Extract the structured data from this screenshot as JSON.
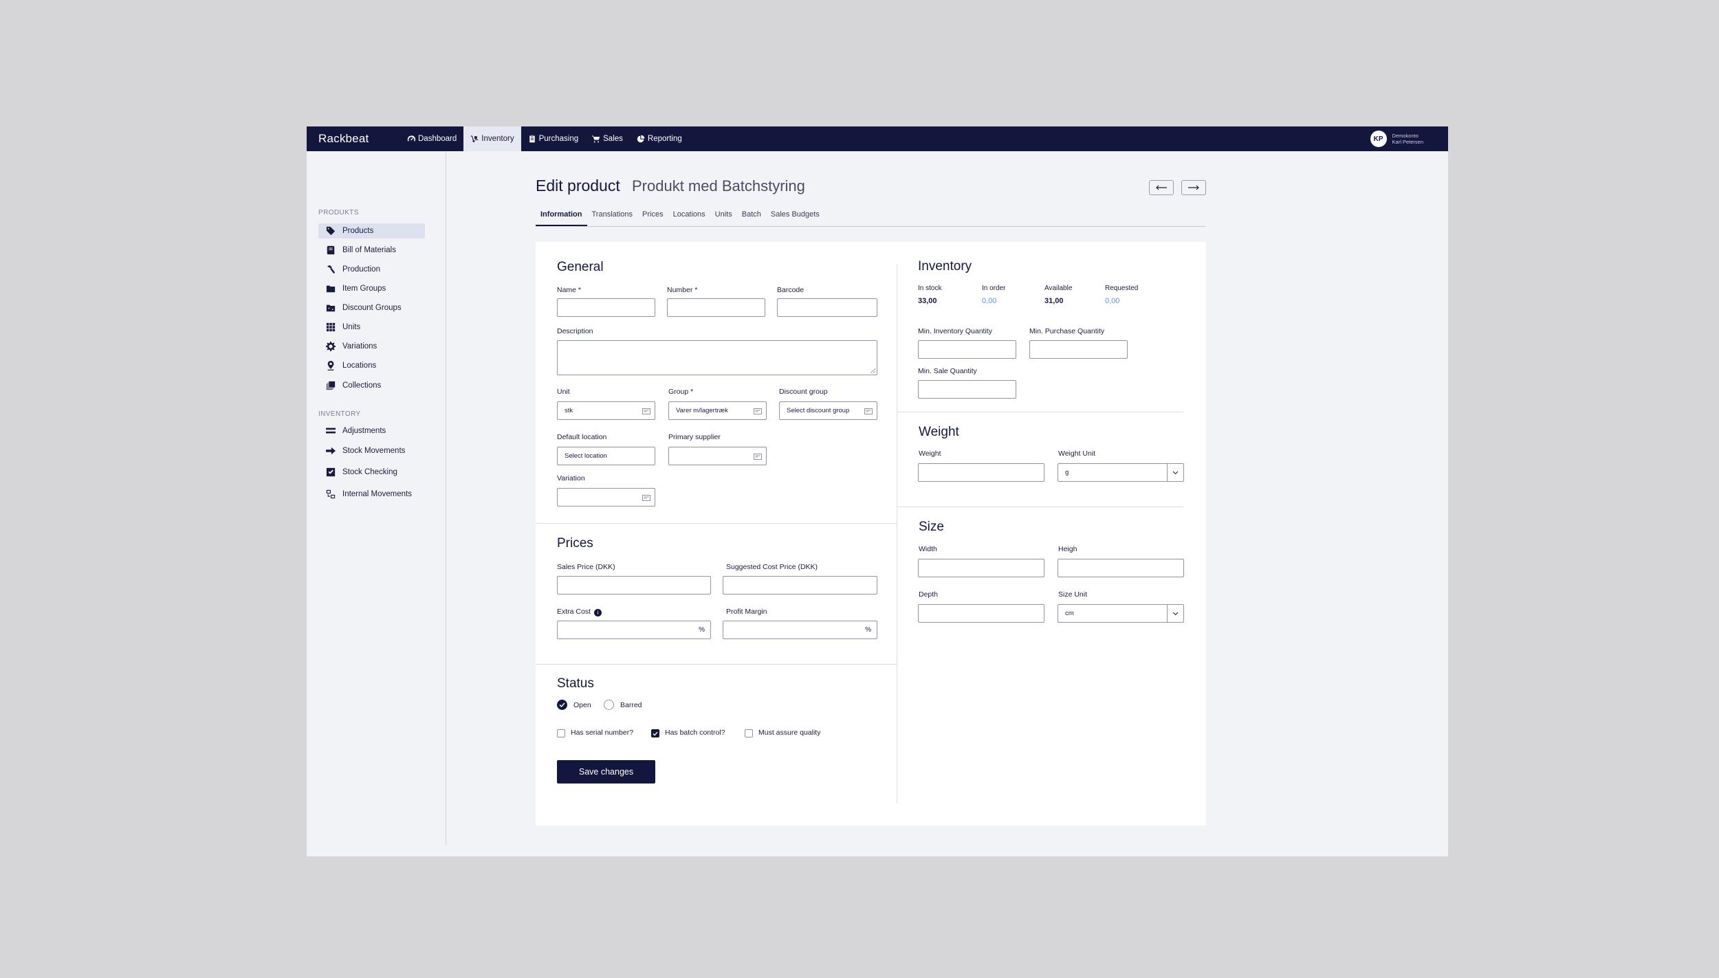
{
  "app": {
    "brand": "Rackbeat"
  },
  "nav": [
    {
      "label": "Dashboard",
      "icon": "gauge-icon"
    },
    {
      "label": "Inventory",
      "icon": "dolly-icon",
      "active": true
    },
    {
      "label": "Purchasing",
      "icon": "clipboard-icon"
    },
    {
      "label": "Sales",
      "icon": "cart-icon"
    },
    {
      "label": "Reporting",
      "icon": "chart-pie-icon"
    }
  ],
  "user": {
    "initials": "KP",
    "line1": "Demokonto",
    "line2": "Karl Petersen"
  },
  "sidebar": {
    "section1": "PRODUKTS",
    "items1": [
      {
        "label": "Products",
        "icon": "tag-icon",
        "active": true
      },
      {
        "label": "Bill of Materials",
        "icon": "book-icon"
      },
      {
        "label": "Production",
        "icon": "hammer-icon"
      },
      {
        "label": "Item Groups",
        "icon": "folder-icon"
      },
      {
        "label": "Discount Groups",
        "icon": "percent-folder-icon"
      },
      {
        "label": "Units",
        "icon": "grid-icon"
      },
      {
        "label": "Variations",
        "icon": "cog-icon"
      },
      {
        "label": "Locations",
        "icon": "map-pin-icon"
      },
      {
        "label": "Collections",
        "icon": "collection-icon"
      }
    ],
    "section2": "INVENTORY",
    "items2": [
      {
        "label": "Adjustments",
        "icon": "sliders-icon"
      },
      {
        "label": "Stock Movements",
        "icon": "arrow-right-icon"
      },
      {
        "label": "Stock Checking",
        "icon": "check-square-icon"
      },
      {
        "label": "Internal Movements",
        "icon": "transfer-icon"
      }
    ]
  },
  "header": {
    "title": "Edit product",
    "subtitle": "Produkt med Batchstyring"
  },
  "tabs": [
    "Information",
    "Translations",
    "Prices",
    "Locations",
    "Units",
    "Batch",
    "Sales Budgets"
  ],
  "general": {
    "title": "General",
    "name_label": "Name *",
    "number_label": "Number *",
    "barcode_label": "Barcode",
    "description_label": "Description",
    "unit_label": "Unit",
    "unit_value": "stk",
    "group_label": "Group *",
    "group_value": "Varer m/lagertræk",
    "discount_label": "Discount group",
    "discount_placeholder": "Select discount group",
    "location_label": "Default location",
    "location_placeholder": "Select location",
    "supplier_label": "Primary supplier",
    "variation_label": "Variation"
  },
  "prices": {
    "title": "Prices",
    "sales_label": "Sales Price (DKK)",
    "cost_label": "Suggested Cost Price (DKK)",
    "extra_label": "Extra Cost",
    "margin_label": "Profit Margin",
    "percent": "%",
    "info": "i"
  },
  "status": {
    "title": "Status",
    "open": "Open",
    "barred": "Barred",
    "serial": "Has serial number?",
    "batch": "Has batch control?",
    "quality": "Must assure quality",
    "save": "Save changes"
  },
  "inventory": {
    "title": "Inventory",
    "in_stock_label": "In stock",
    "in_stock": "33,00",
    "in_order_label": "In order",
    "in_order": "0,00",
    "available_label": "Available",
    "available": "31,00",
    "requested_label": "Requested",
    "requested": "0,00",
    "min_inv_label": "Min. Inventory Quantity",
    "min_purchase_label": "Min. Purchase Quantity",
    "min_sale_label": "Min. Sale Quantity"
  },
  "weight": {
    "title": "Weight",
    "weight_label": "Weight",
    "unit_label": "Weight Unit",
    "unit_value": "g"
  },
  "size": {
    "title": "Size",
    "width_label": "Width",
    "height_label": "Heigh",
    "depth_label": "Depth",
    "unit_label": "Size Unit",
    "unit_value": "cm"
  }
}
